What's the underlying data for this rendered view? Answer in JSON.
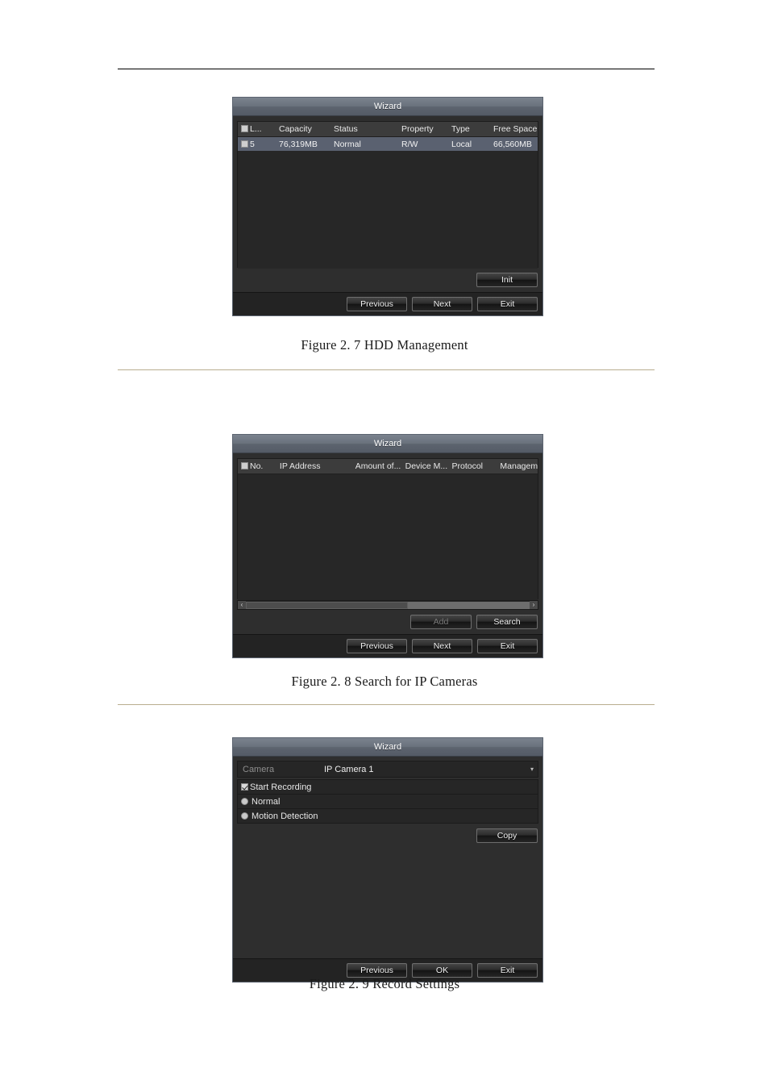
{
  "page": {
    "background": "#ffffff",
    "rule_color_header": "#000000",
    "rule_color_section": "#b9ad8f"
  },
  "figures": [
    {
      "caption": "Figure 2. 7 HDD Management",
      "dialog": {
        "title": "Wizard",
        "table": {
          "headers": [
            "L...",
            "Capacity",
            "Status",
            "Property",
            "Type",
            "Free Space"
          ],
          "rows": [
            {
              "selected": false,
              "cells": [
                "5",
                "76,319MB",
                "Normal",
                "R/W",
                "Local",
                "66,560MB"
              ]
            }
          ]
        },
        "action_buttons": [
          {
            "label": "Init",
            "enabled": true
          }
        ],
        "footer_buttons": [
          {
            "label": "Previous",
            "enabled": true
          },
          {
            "label": "Next",
            "enabled": true
          },
          {
            "label": "Exit",
            "enabled": true
          }
        ]
      }
    },
    {
      "caption": "Figure 2. 8 Search for IP Cameras",
      "dialog": {
        "title": "Wizard",
        "table": {
          "headers": [
            "No.",
            "IP Address",
            "Amount of...",
            "Device M...",
            "Protocol",
            "Managem"
          ],
          "rows": []
        },
        "scrollbar": {
          "left_arrow": "‹",
          "right_arrow": "›",
          "thumb_percent": 57
        },
        "action_buttons": [
          {
            "label": "Add",
            "enabled": false
          },
          {
            "label": "Search",
            "enabled": true
          }
        ],
        "footer_buttons": [
          {
            "label": "Previous",
            "enabled": true
          },
          {
            "label": "Next",
            "enabled": true
          },
          {
            "label": "Exit",
            "enabled": true
          }
        ]
      }
    },
    {
      "caption": "Figure 2. 9 Record Settings",
      "dialog": {
        "title": "Wizard",
        "camera_field": {
          "label": "Camera",
          "value": "IP Camera 1",
          "caret": "▾"
        },
        "options": [
          {
            "type": "checkbox",
            "label": "Start Recording",
            "checked": true
          },
          {
            "type": "radio",
            "label": "Normal",
            "checked": false
          },
          {
            "type": "radio",
            "label": "Motion Detection",
            "checked": false
          }
        ],
        "action_buttons": [
          {
            "label": "Copy",
            "enabled": true
          }
        ],
        "footer_buttons": [
          {
            "label": "Previous",
            "enabled": true
          },
          {
            "label": "OK",
            "enabled": true
          },
          {
            "label": "Exit",
            "enabled": true
          }
        ]
      }
    }
  ]
}
